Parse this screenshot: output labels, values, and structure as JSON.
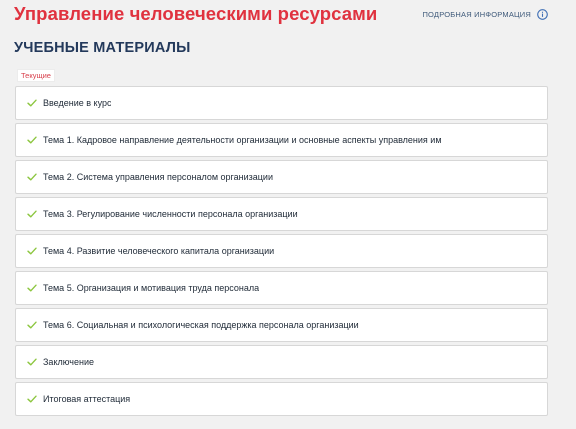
{
  "header": {
    "course_title": "Управление человеческими ресурсами",
    "more_info_label": "ПОДРОБНАЯ ИНФОРМАЦИЯ",
    "info_icon": "info-circle-icon"
  },
  "section": {
    "title": "УЧЕБНЫЕ МАТЕРИАЛЫ",
    "current_badge": "Текущие"
  },
  "colors": {
    "title_red": "#e0323f",
    "navy": "#23395b",
    "check_green": "#8cc63f",
    "info_blue": "#3f6fb5"
  },
  "materials": [
    {
      "label": "Введение в курс",
      "completed": true
    },
    {
      "label": "Тема 1. Кадровое направление деятельности организации и основные аспекты управления им",
      "completed": true
    },
    {
      "label": "Тема 2. Система управления персоналом организации",
      "completed": true
    },
    {
      "label": "Тема 3. Регулирование численности персонала организации",
      "completed": true
    },
    {
      "label": "Тема 4. Развитие человеческого капитала организации",
      "completed": true
    },
    {
      "label": "Тема 5. Организация и мотивация труда персонала",
      "completed": true
    },
    {
      "label": "Тема 6. Социальная и психологическая поддержка персонала организации",
      "completed": true
    },
    {
      "label": "Заключение",
      "completed": true
    },
    {
      "label": "Итоговая аттестация",
      "completed": true
    }
  ]
}
